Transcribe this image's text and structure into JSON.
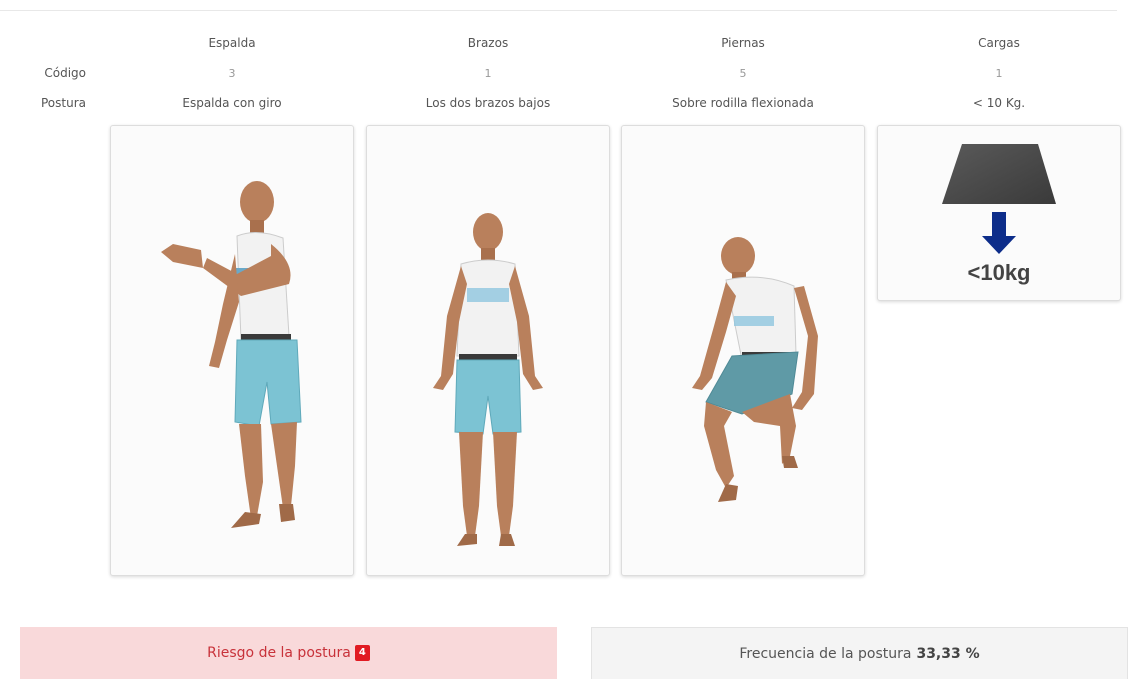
{
  "columns": [
    {
      "header": "Espalda",
      "code": "3",
      "posture": "Espalda con giro"
    },
    {
      "header": "Brazos",
      "code": "1",
      "posture": "Los dos brazos bajos"
    },
    {
      "header": "Piernas",
      "code": "5",
      "posture": "Sobre rodilla flexionada"
    },
    {
      "header": "Cargas",
      "code": "1",
      "posture": "< 10 Kg."
    }
  ],
  "row_labels": {
    "code": "Código",
    "posture": "Postura"
  },
  "load_image_text": "<10kg",
  "risk": {
    "label": "Riesgo de la postura",
    "value": "4"
  },
  "frequency": {
    "label": "Frecuencia de la postura",
    "value": "33,33 %"
  },
  "colors": {
    "risk_bg": "#f9d9da",
    "risk_text": "#c8323a",
    "badge": "#e11b22",
    "shirt": "#f2f2f2",
    "shorts": "#7cc3d3",
    "skin": "#b9805c",
    "arrow": "#0d2d8a"
  }
}
